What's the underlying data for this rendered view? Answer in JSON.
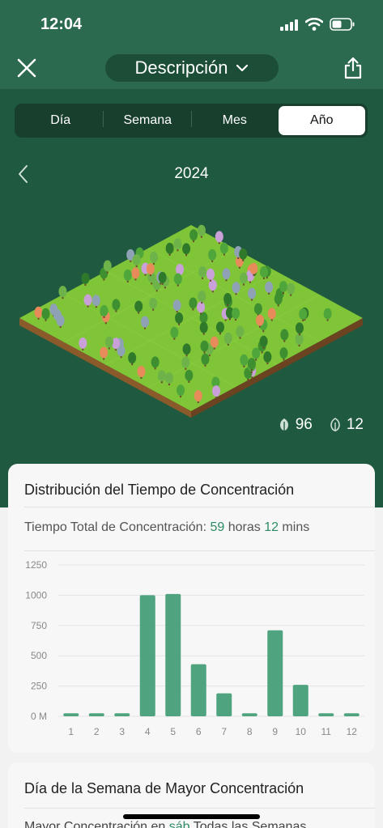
{
  "status_bar": {
    "time": "12:04"
  },
  "nav": {
    "title": "Descripción"
  },
  "segments": [
    "Día",
    "Semana",
    "Mes",
    "Año"
  ],
  "active_segment": "Año",
  "period": {
    "label": "2024"
  },
  "counts": {
    "alive": "96",
    "withered": "12"
  },
  "distribution": {
    "title": "Distribución del Tiempo de Concentración",
    "total_prefix": "Tiempo Total de Concentración: ",
    "hours_value": "59",
    "hours_unit": " horas ",
    "mins_value": "12",
    "mins_unit": " mins"
  },
  "weekday": {
    "title": "Día de la Semana de Mayor Concentración",
    "text_prefix": "Mayor Concentración en ",
    "day": "sáb",
    "text_suffix": " Todas las Semanas"
  },
  "colors": {
    "accent": "#2e8b63",
    "bar": "#4fa47f",
    "header": "#2b6a4e",
    "background": "#1f5a40"
  },
  "chart_data": {
    "type": "bar",
    "categories": [
      "1",
      "2",
      "3",
      "4",
      "5",
      "6",
      "7",
      "8",
      "9",
      "10",
      "11",
      "12"
    ],
    "values": [
      25,
      25,
      25,
      1000,
      1010,
      430,
      190,
      25,
      710,
      260,
      25,
      25
    ],
    "y_ticks": [
      "0 M",
      "250",
      "500",
      "750",
      "1000",
      "1250"
    ],
    "ylim": [
      0,
      1250
    ],
    "grid": true
  }
}
